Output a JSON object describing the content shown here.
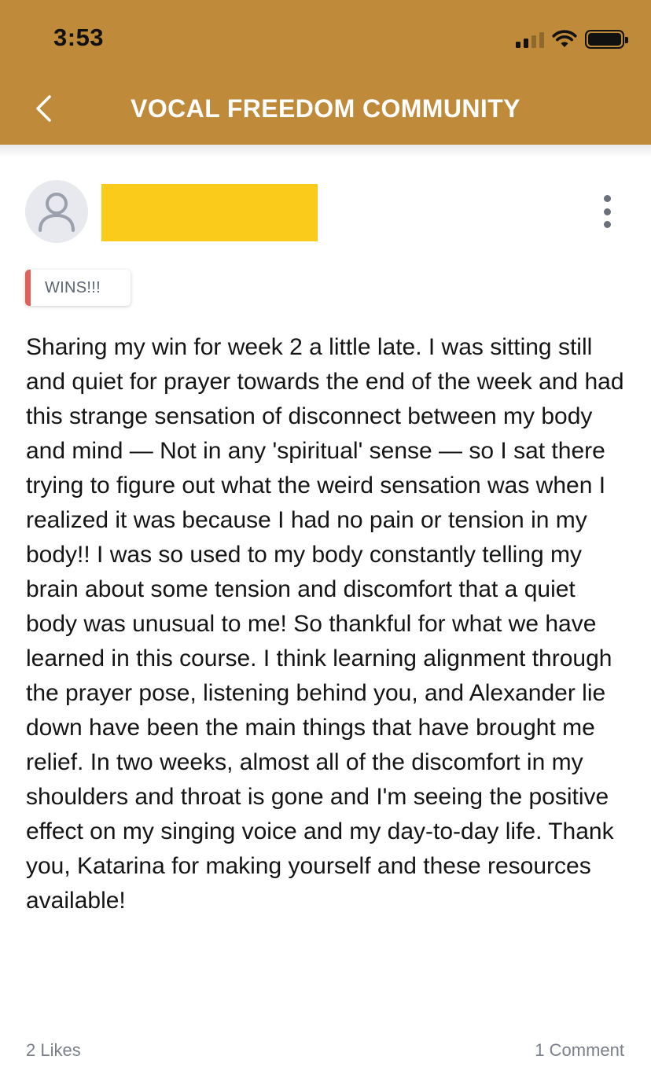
{
  "status_bar": {
    "time": "3:53"
  },
  "nav": {
    "title": "VOCAL FREEDOM COMMUNITY",
    "back_icon": "chevron-left-icon"
  },
  "colors": {
    "header": "#bf8b3a",
    "redaction": "#fbcb1c",
    "tag_accent": "#e0615a"
  },
  "post": {
    "tag": "WINS!!!",
    "body": "Sharing my win for week 2 a little late. I was sitting still and quiet for prayer towards the end of the week and had this strange sensation of disconnect between my body and mind — Not in any 'spiritual' sense — so I sat there trying to figure out what the weird sensation was when I realized it was because I had no pain or tension in my body!! I was so used to my body constantly telling my brain about some tension and discomfort that a quiet body was unusual to me! So thankful for what we have learned in this course. I think learning alignment through the prayer pose, listening behind you, and Alexander lie down have been the main things that have brought me relief. In two weeks, almost all of the discomfort in my shoulders and throat is gone and I'm seeing the positive effect on my singing voice and my day-to-day life. Thank you, Katarina for making yourself and these resources available!",
    "likes": "2 Likes",
    "comments": "1 Comment"
  }
}
